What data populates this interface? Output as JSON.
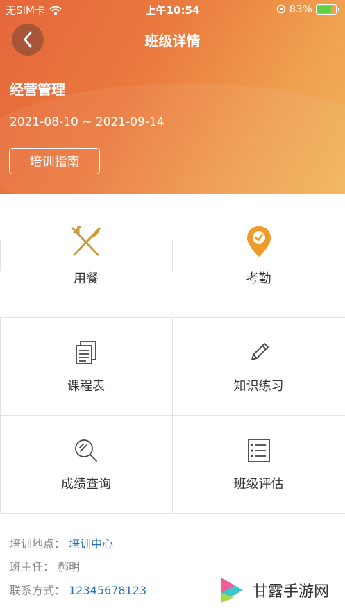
{
  "status": {
    "carrier": "无SIM卡",
    "time": "上午10:54",
    "battery": "83%",
    "battery_level": 0.83
  },
  "nav": {
    "title": "班级详情"
  },
  "class": {
    "name": "经营管理",
    "dates": "2021-08-10 ~ 2021-09-14",
    "guide_label": "培训指南"
  },
  "menu": {
    "dining": "用餐",
    "attendance": "考勤",
    "schedule": "课程表",
    "practice": "知识练习",
    "grades": "成绩查询",
    "evaluation": "班级评估"
  },
  "info": {
    "location_label": "培训地点：",
    "location_value": "培训中心",
    "teacher_label": "班主任：",
    "teacher_value": "郝明",
    "contact_label": "联系方式：",
    "contact_value": "12345678123"
  },
  "watermark": {
    "text": "甘露手游网"
  },
  "colors": {
    "header_start": "#e5663a",
    "header_end": "#f2b45c",
    "link": "#2a6fb0",
    "gold_icon": "#c79a3c",
    "location_icon": "#f09a2a"
  }
}
